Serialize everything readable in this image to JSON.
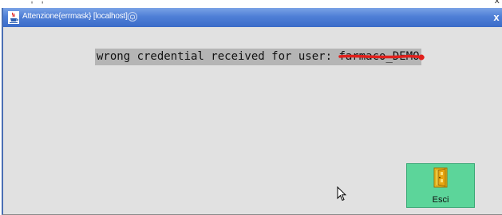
{
  "dialog": {
    "title": "Attenzione{errmask} [localhost]",
    "close_glyph": "x",
    "message_prefix": "wrong credential received for user: ",
    "message_user": "farmaco_DEMO",
    "exit_label": "Esci"
  },
  "icons": {
    "title_icon": "java-cup-icon",
    "title_status_icon": "bell-icon",
    "exit_icon": "exit-door-icon",
    "cursor": "mouse-pointer-icon"
  },
  "colors": {
    "titlebar": "#4f7fd6",
    "background": "#e1e1e1",
    "message_highlight": "#b5b5b5",
    "exit_button": "#5cd59a",
    "redaction": "#e0201c"
  },
  "behind_window": {
    "close_glyph": "x"
  }
}
